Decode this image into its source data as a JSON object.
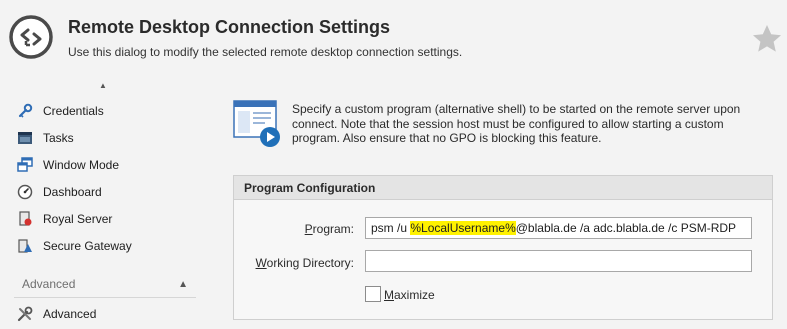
{
  "header": {
    "title": "Remote Desktop Connection Settings",
    "subtitle": "Use this dialog to modify the selected remote desktop connection settings.",
    "logo_icon": "remote-desktop-icon",
    "favorite_icon": "star-icon"
  },
  "sidebar": {
    "scroll_up": "▲",
    "items": [
      {
        "label": "Credentials",
        "icon": "key-icon"
      },
      {
        "label": "Tasks",
        "icon": "tasks-icon"
      },
      {
        "label": "Window Mode",
        "icon": "window-mode-icon"
      },
      {
        "label": "Dashboard",
        "icon": "dashboard-icon"
      },
      {
        "label": "Royal Server",
        "icon": "royal-server-icon"
      },
      {
        "label": "Secure Gateway",
        "icon": "secure-gateway-icon"
      }
    ],
    "sections": [
      {
        "label": "Advanced",
        "expanded": true,
        "chevron": "▲"
      }
    ],
    "section_items": [
      {
        "label": "Advanced",
        "icon": "tools-icon"
      }
    ]
  },
  "main": {
    "info_icon": "program-play-icon",
    "info_text": "Specify a custom program (alternative shell) to be started on the remote server upon connect. Note that the session host must be configured to allow starting a custom program. Also ensure that no GPO is blocking this feature.",
    "group_title": "Program Configuration",
    "program": {
      "label_prefix": "",
      "label_underline": "P",
      "label_rest": "rogram:",
      "value_before": "psm /u ",
      "value_highlight": "%LocalUsername%",
      "value_after": "@blabla.de /a adc.blabla.de /c PSM-RDP"
    },
    "working_directory": {
      "label_underline": "W",
      "label_rest": "orking Directory:",
      "value": ""
    },
    "maximize": {
      "label_underline": "M",
      "label_rest": "aximize",
      "checked": false
    }
  },
  "colors": {
    "highlight": "#fff200",
    "accent": "#1f6fb8",
    "background": "#f3f3f3"
  }
}
